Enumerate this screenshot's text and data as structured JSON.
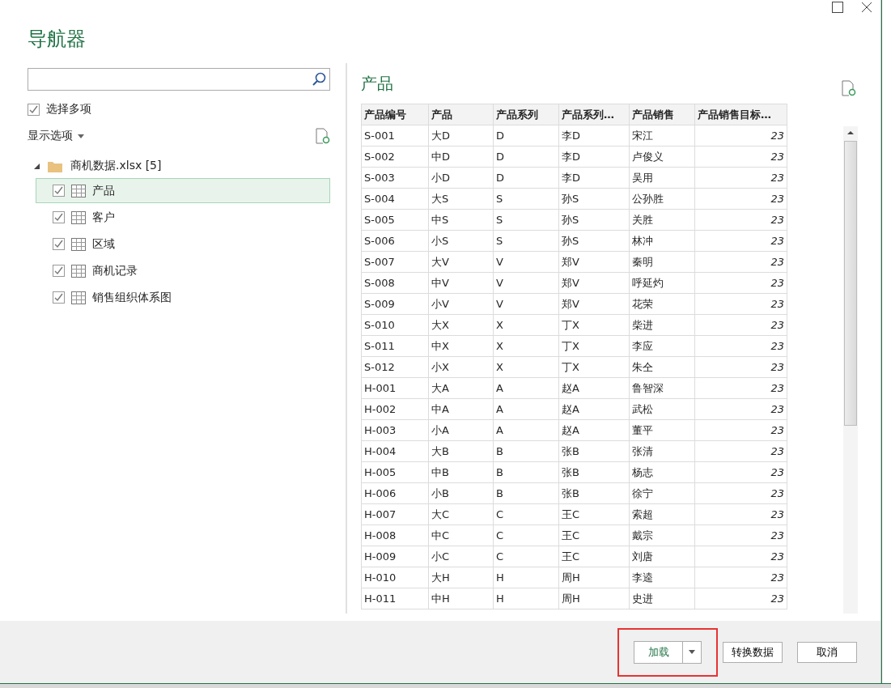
{
  "window": {
    "title": "导航器"
  },
  "select_multiple": {
    "label": "选择多项",
    "checked": true
  },
  "display_options": {
    "label": "显示选项"
  },
  "tree": {
    "label": "商机数据.xlsx [5]",
    "expanded": true,
    "children": [
      {
        "label": "产品",
        "checked": true,
        "selected": true
      },
      {
        "label": "客户",
        "checked": true,
        "selected": false
      },
      {
        "label": "区域",
        "checked": true,
        "selected": false
      },
      {
        "label": "商机记录",
        "checked": true,
        "selected": false
      },
      {
        "label": "销售组织体系图",
        "checked": true,
        "selected": false
      }
    ]
  },
  "preview": {
    "title": "产品",
    "columns": [
      "产品编号",
      "产品",
      "产品系列",
      "产品系列…",
      "产品销售",
      "产品销售目标…"
    ],
    "rows": [
      [
        "S-001",
        "大D",
        "D",
        "李D",
        "宋江",
        "23"
      ],
      [
        "S-002",
        "中D",
        "D",
        "李D",
        "卢俊义",
        "23"
      ],
      [
        "S-003",
        "小D",
        "D",
        "李D",
        "吴用",
        "23"
      ],
      [
        "S-004",
        "大S",
        "S",
        "孙S",
        "公孙胜",
        "23"
      ],
      [
        "S-005",
        "中S",
        "S",
        "孙S",
        "关胜",
        "23"
      ],
      [
        "S-006",
        "小S",
        "S",
        "孙S",
        "林冲",
        "23"
      ],
      [
        "S-007",
        "大V",
        "V",
        "郑V",
        "秦明",
        "23"
      ],
      [
        "S-008",
        "中V",
        "V",
        "郑V",
        "呼延灼",
        "23"
      ],
      [
        "S-009",
        "小V",
        "V",
        "郑V",
        "花荣",
        "23"
      ],
      [
        "S-010",
        "大X",
        "X",
        "丁X",
        "柴进",
        "23"
      ],
      [
        "S-011",
        "中X",
        "X",
        "丁X",
        "李应",
        "23"
      ],
      [
        "S-012",
        "小X",
        "X",
        "丁X",
        "朱仝",
        "23"
      ],
      [
        "H-001",
        "大A",
        "A",
        "赵A",
        "鲁智深",
        "23"
      ],
      [
        "H-002",
        "中A",
        "A",
        "赵A",
        "武松",
        "23"
      ],
      [
        "H-003",
        "小A",
        "A",
        "赵A",
        "董平",
        "23"
      ],
      [
        "H-004",
        "大B",
        "B",
        "张B",
        "张清",
        "23"
      ],
      [
        "H-005",
        "中B",
        "B",
        "张B",
        "杨志",
        "23"
      ],
      [
        "H-006",
        "小B",
        "B",
        "张B",
        "徐宁",
        "23"
      ],
      [
        "H-007",
        "大C",
        "C",
        "王C",
        "索超",
        "23"
      ],
      [
        "H-008",
        "中C",
        "C",
        "王C",
        "戴宗",
        "23"
      ],
      [
        "H-009",
        "小C",
        "C",
        "王C",
        "刘唐",
        "23"
      ],
      [
        "H-010",
        "大H",
        "H",
        "周H",
        "李逵",
        "23"
      ],
      [
        "H-011",
        "中H",
        "H",
        "周H",
        "史进",
        "23"
      ]
    ]
  },
  "buttons": [
    {
      "kind": "split",
      "label": "加载",
      "highlighted": true
    },
    {
      "kind": "plain",
      "label": "转换数据",
      "highlighted": false
    },
    {
      "kind": "plain",
      "label": "取消",
      "highlighted": false
    }
  ]
}
